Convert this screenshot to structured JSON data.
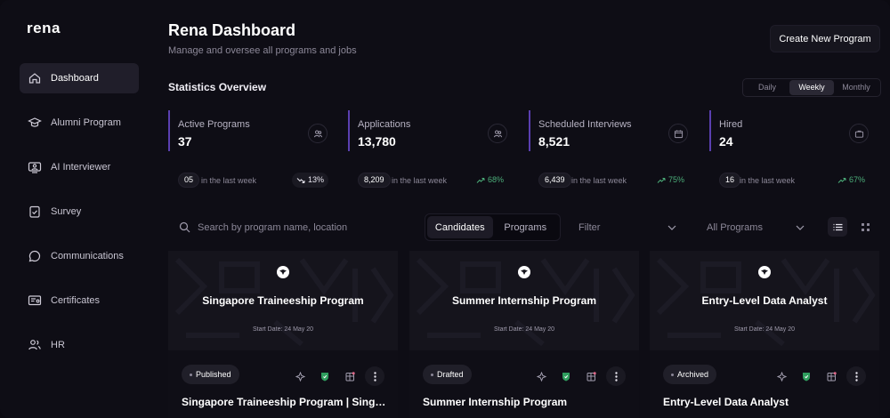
{
  "sidebar": {
    "logo": "rena",
    "items": [
      {
        "label": "Dashboard",
        "icon": "home-icon",
        "active": true
      },
      {
        "label": "Alumni Program",
        "icon": "graduation-cap-icon",
        "active": false
      },
      {
        "label": "AI Interviewer",
        "icon": "video-user-icon",
        "active": false
      },
      {
        "label": "Survey",
        "icon": "clipboard-check-icon",
        "active": false
      },
      {
        "label": "Communications",
        "icon": "chat-bubble-icon",
        "active": false
      },
      {
        "label": "Certificates",
        "icon": "certificate-icon",
        "active": false
      },
      {
        "label": "HR",
        "icon": "user-group-icon",
        "active": false
      }
    ]
  },
  "header": {
    "title": "Rena Dashboard",
    "subtitle": "Manage and oversee all programs and jobs",
    "create_label": "Create New Program"
  },
  "stats": {
    "title": "Statistics Overview",
    "periods": [
      "Daily",
      "Weekly",
      "Monthly"
    ],
    "active_period": "Weekly",
    "cards": [
      {
        "label": "Active Programs",
        "value": "37",
        "icon": "users-icon",
        "week_count": "05",
        "since": "in the last week",
        "trend": "13%",
        "direction": "down"
      },
      {
        "label": "Applications",
        "value": "13,780",
        "icon": "users-icon",
        "week_count": "8,209",
        "since": "in the last week",
        "trend": "68%",
        "direction": "up"
      },
      {
        "label": "Scheduled Interviews",
        "value": "8,521",
        "icon": "calendar-icon",
        "week_count": "6,439",
        "since": "in the last week",
        "trend": "75%",
        "direction": "up"
      },
      {
        "label": "Hired",
        "value": "24",
        "icon": "briefcase-icon",
        "week_count": "16",
        "since": "in the last week",
        "trend": "67%",
        "direction": "up"
      }
    ]
  },
  "toolbar": {
    "search_placeholder": "Search by program name, location",
    "tabs": [
      "Candidates",
      "Programs"
    ],
    "active_tab": "Candidates",
    "filter_label": "Filter",
    "programs_select": "All Programs"
  },
  "programs": [
    {
      "banner_title": "Singapore Traineeship Program",
      "start": "Start Date: 24 May 20",
      "status": "Published",
      "title": "Singapore Traineeship Program | Singapore"
    },
    {
      "banner_title": "Summer Internship Program",
      "start": "Start Date: 24 May 20",
      "status": "Drafted",
      "title": "Summer Internship Program"
    },
    {
      "banner_title": "Entry-Level Data Analyst",
      "start": "Start Date: 24 May 20",
      "status": "Archived",
      "title": "Entry-Level Data Analyst"
    }
  ],
  "colors": {
    "accent": "#5a3fb0",
    "positive": "#4caf7a",
    "badge_green": "#2f9e5e",
    "badge_pink": "#e06a8a"
  }
}
